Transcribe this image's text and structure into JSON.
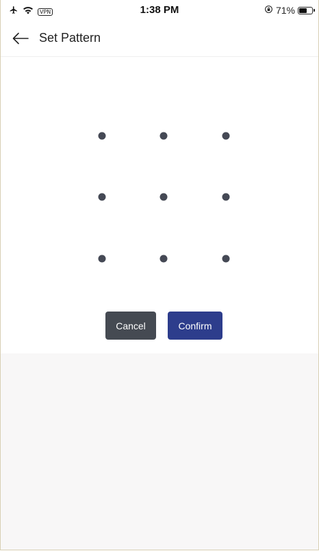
{
  "status_bar": {
    "time": "1:38 PM",
    "vpn": "VPN",
    "battery_percent": "71%",
    "battery_level": 0.71,
    "icons": [
      "airplane-icon",
      "wifi-icon",
      "vpn-icon",
      "orientation-lock-icon",
      "battery-icon"
    ]
  },
  "header": {
    "title": "Set Pattern",
    "back_icon": "back-arrow-icon"
  },
  "pattern": {
    "rows": 3,
    "cols": 3,
    "dot_color": "#454955"
  },
  "buttons": {
    "cancel_label": "Cancel",
    "confirm_label": "Confirm",
    "cancel_color": "#454a52",
    "confirm_color": "#2d3d8c"
  },
  "colors": {
    "background": "#ffffff",
    "lower_background": "#f8f7f7"
  }
}
